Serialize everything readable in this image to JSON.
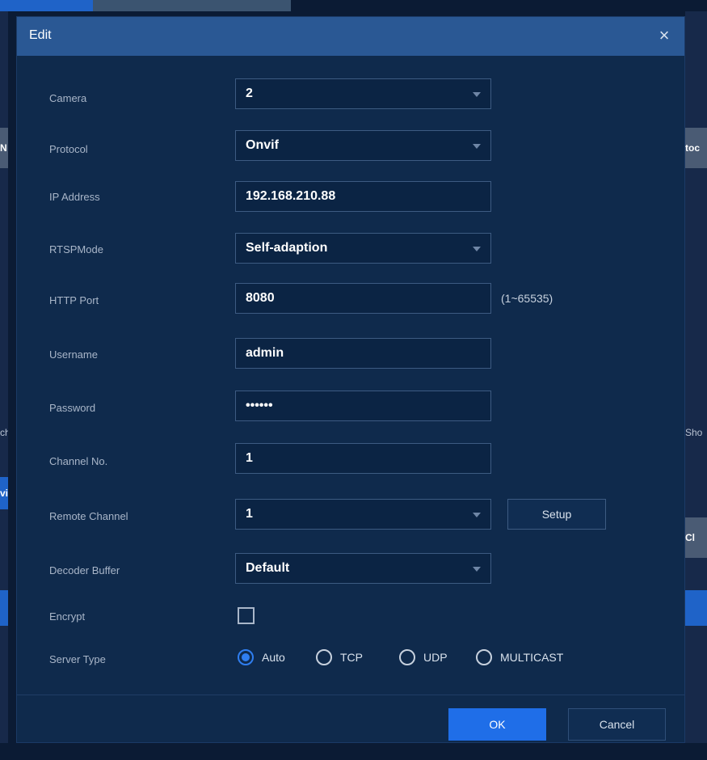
{
  "dialog": {
    "title": "Edit",
    "close_glyph": "×"
  },
  "form": {
    "camera": {
      "label": "Camera",
      "value": "2"
    },
    "protocol": {
      "label": "Protocol",
      "value": "Onvif"
    },
    "ip_address": {
      "label": "IP Address",
      "value": "192.168.210.88"
    },
    "rtsp_mode": {
      "label": "RTSPMode",
      "value": "Self-adaption"
    },
    "http_port": {
      "label": "HTTP Port",
      "value": "8080",
      "hint": "(1~65535)"
    },
    "username": {
      "label": "Username",
      "value": "admin"
    },
    "password": {
      "label": "Password",
      "value": "••••••"
    },
    "channel_no": {
      "label": "Channel No.",
      "value": "1"
    },
    "remote_channel": {
      "label": "Remote Channel",
      "value": "1",
      "setup_label": "Setup"
    },
    "decoder_buffer": {
      "label": "Decoder Buffer",
      "value": "Default"
    },
    "encrypt": {
      "label": "Encrypt",
      "checked": false
    },
    "server_type": {
      "label": "Server Type",
      "options": [
        "Auto",
        "TCP",
        "UDP",
        "MULTICAST"
      ],
      "selected": "Auto"
    }
  },
  "buttons": {
    "ok": "OK",
    "cancel": "Cancel"
  },
  "background": {
    "fragments": [
      "N",
      "toc",
      "ch",
      "Sho",
      "vi",
      "Cl"
    ]
  },
  "colors": {
    "accent": "#1f6ee8",
    "header": "#2a5894",
    "panel": "#0f2a4c"
  },
  "icons": {
    "dropdown": "chevron-down-icon",
    "close": "close-icon"
  }
}
